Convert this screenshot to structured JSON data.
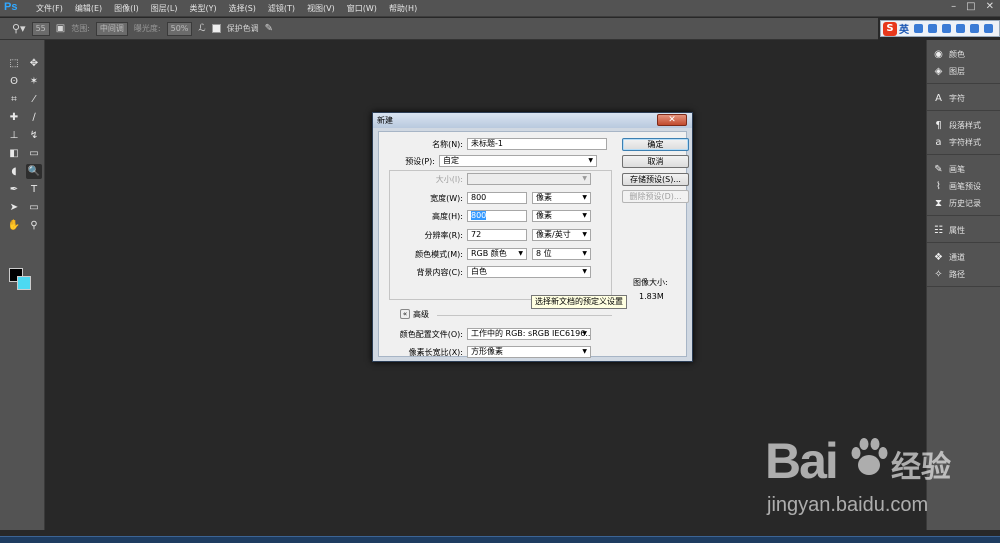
{
  "app": {
    "logo": "Ps",
    "accent": "#31a8ff"
  },
  "menubar": {
    "items": [
      "文件(F)",
      "编辑(E)",
      "图像(I)",
      "图层(L)",
      "类型(Y)",
      "选择(S)",
      "滤镜(T)",
      "视图(V)",
      "窗口(W)",
      "帮助(H)"
    ],
    "window_controls": [
      "–",
      "□",
      "✕"
    ]
  },
  "ime": {
    "logo": "S",
    "lang": "英"
  },
  "optionsbar": {
    "brush_size": "55",
    "range_label": "范围:",
    "range_value": "中间调",
    "exposure_label": "曝光度:",
    "exposure_value": "50%",
    "protect_tones": "保护色调"
  },
  "tools": [
    {
      "name": "marquee-icon",
      "glyph": "⬚"
    },
    {
      "name": "move-icon",
      "glyph": "✥"
    },
    {
      "name": "lasso-icon",
      "glyph": "ʘ"
    },
    {
      "name": "magic-wand-icon",
      "glyph": "✶"
    },
    {
      "name": "crop-icon",
      "glyph": "⌗"
    },
    {
      "name": "eyedropper-icon",
      "glyph": "⁄"
    },
    {
      "name": "healing-icon",
      "glyph": "✚"
    },
    {
      "name": "brush-icon",
      "glyph": "∕"
    },
    {
      "name": "stamp-icon",
      "glyph": "⊥"
    },
    {
      "name": "history-brush-icon",
      "glyph": "↯"
    },
    {
      "name": "eraser-icon",
      "glyph": "◧"
    },
    {
      "name": "gradient-icon",
      "glyph": "▭"
    },
    {
      "name": "blur-icon",
      "glyph": "◖"
    },
    {
      "name": "dodge-icon",
      "glyph": "🔍"
    },
    {
      "name": "pen-icon",
      "glyph": "✒"
    },
    {
      "name": "type-icon",
      "glyph": "T"
    },
    {
      "name": "path-selection-icon",
      "glyph": "➤"
    },
    {
      "name": "rectangle-shape-icon",
      "glyph": "▭"
    },
    {
      "name": "hand-icon",
      "glyph": "✋"
    },
    {
      "name": "zoom-icon",
      "glyph": "⚲"
    }
  ],
  "colors": {
    "foreground": "#000000",
    "background": "#4cd9f2"
  },
  "right_panel": {
    "groups": [
      [
        {
          "icon": "palette-icon",
          "glyph": "◉",
          "label": "颜色"
        },
        {
          "icon": "layers-icon",
          "glyph": "◈",
          "label": "图层"
        }
      ],
      [
        {
          "icon": "character-icon",
          "glyph": "A",
          "label": "字符"
        }
      ],
      [
        {
          "icon": "paragraph-style-icon",
          "glyph": "¶",
          "label": "段落样式"
        },
        {
          "icon": "character-style-icon",
          "glyph": "a",
          "label": "字符样式"
        }
      ],
      [
        {
          "icon": "brush-icon",
          "glyph": "✎",
          "label": "画笔"
        },
        {
          "icon": "brush-presets-icon",
          "glyph": "⌇",
          "label": "画笔预设"
        },
        {
          "icon": "history-icon",
          "glyph": "⧗",
          "label": "历史记录"
        }
      ],
      [
        {
          "icon": "properties-icon",
          "glyph": "☷",
          "label": "属性"
        }
      ],
      [
        {
          "icon": "channels-icon",
          "glyph": "❖",
          "label": "通道"
        },
        {
          "icon": "paths-icon",
          "glyph": "✧",
          "label": "路径"
        }
      ]
    ]
  },
  "dialog": {
    "title": "新建",
    "close": "✕",
    "name_label": "名称(N):",
    "name_value": "未标题-1",
    "preset_label": "预设(P):",
    "preset_value": "自定",
    "size_label": "大小(I):",
    "size_value": "",
    "width_label": "宽度(W):",
    "width_value": "800",
    "width_unit": "像素",
    "height_label": "高度(H):",
    "height_value": "800",
    "height_unit": "像素",
    "resolution_label": "分辨率(R):",
    "resolution_value": "72",
    "resolution_unit": "像素/英寸",
    "mode_label": "颜色模式(M):",
    "mode_value": "RGB 颜色",
    "bits_value": "8 位",
    "background_label": "背景内容(C):",
    "background_value": "白色",
    "advanced_label": "高级",
    "profile_label": "颜色配置文件(O):",
    "profile_value": "工作中的 RGB: sRGB IEC6196...",
    "aspect_label": "像素长宽比(X):",
    "aspect_value": "方形像素",
    "ok": "确定",
    "cancel": "取消",
    "save_preset": "存储预设(S)...",
    "delete_preset": "删除预设(D)...",
    "image_size_label": "图像大小:",
    "image_size_value": "1.83M"
  },
  "tooltip": "选择新文档的预定义设置",
  "watermark": {
    "logo": "Bai",
    "logo2": "经验",
    "url": "jingyan.baidu.com"
  }
}
